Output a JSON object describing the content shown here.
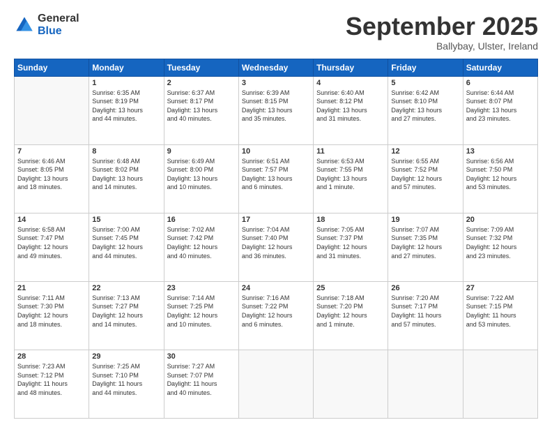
{
  "logo": {
    "general": "General",
    "blue": "Blue"
  },
  "header": {
    "title": "September 2025",
    "location": "Ballybay, Ulster, Ireland"
  },
  "days_of_week": [
    "Sunday",
    "Monday",
    "Tuesday",
    "Wednesday",
    "Thursday",
    "Friday",
    "Saturday"
  ],
  "weeks": [
    [
      {
        "day": "",
        "info": ""
      },
      {
        "day": "1",
        "info": "Sunrise: 6:35 AM\nSunset: 8:19 PM\nDaylight: 13 hours\nand 44 minutes."
      },
      {
        "day": "2",
        "info": "Sunrise: 6:37 AM\nSunset: 8:17 PM\nDaylight: 13 hours\nand 40 minutes."
      },
      {
        "day": "3",
        "info": "Sunrise: 6:39 AM\nSunset: 8:15 PM\nDaylight: 13 hours\nand 35 minutes."
      },
      {
        "day": "4",
        "info": "Sunrise: 6:40 AM\nSunset: 8:12 PM\nDaylight: 13 hours\nand 31 minutes."
      },
      {
        "day": "5",
        "info": "Sunrise: 6:42 AM\nSunset: 8:10 PM\nDaylight: 13 hours\nand 27 minutes."
      },
      {
        "day": "6",
        "info": "Sunrise: 6:44 AM\nSunset: 8:07 PM\nDaylight: 13 hours\nand 23 minutes."
      }
    ],
    [
      {
        "day": "7",
        "info": "Sunrise: 6:46 AM\nSunset: 8:05 PM\nDaylight: 13 hours\nand 18 minutes."
      },
      {
        "day": "8",
        "info": "Sunrise: 6:48 AM\nSunset: 8:02 PM\nDaylight: 13 hours\nand 14 minutes."
      },
      {
        "day": "9",
        "info": "Sunrise: 6:49 AM\nSunset: 8:00 PM\nDaylight: 13 hours\nand 10 minutes."
      },
      {
        "day": "10",
        "info": "Sunrise: 6:51 AM\nSunset: 7:57 PM\nDaylight: 13 hours\nand 6 minutes."
      },
      {
        "day": "11",
        "info": "Sunrise: 6:53 AM\nSunset: 7:55 PM\nDaylight: 13 hours\nand 1 minute."
      },
      {
        "day": "12",
        "info": "Sunrise: 6:55 AM\nSunset: 7:52 PM\nDaylight: 12 hours\nand 57 minutes."
      },
      {
        "day": "13",
        "info": "Sunrise: 6:56 AM\nSunset: 7:50 PM\nDaylight: 12 hours\nand 53 minutes."
      }
    ],
    [
      {
        "day": "14",
        "info": "Sunrise: 6:58 AM\nSunset: 7:47 PM\nDaylight: 12 hours\nand 49 minutes."
      },
      {
        "day": "15",
        "info": "Sunrise: 7:00 AM\nSunset: 7:45 PM\nDaylight: 12 hours\nand 44 minutes."
      },
      {
        "day": "16",
        "info": "Sunrise: 7:02 AM\nSunset: 7:42 PM\nDaylight: 12 hours\nand 40 minutes."
      },
      {
        "day": "17",
        "info": "Sunrise: 7:04 AM\nSunset: 7:40 PM\nDaylight: 12 hours\nand 36 minutes."
      },
      {
        "day": "18",
        "info": "Sunrise: 7:05 AM\nSunset: 7:37 PM\nDaylight: 12 hours\nand 31 minutes."
      },
      {
        "day": "19",
        "info": "Sunrise: 7:07 AM\nSunset: 7:35 PM\nDaylight: 12 hours\nand 27 minutes."
      },
      {
        "day": "20",
        "info": "Sunrise: 7:09 AM\nSunset: 7:32 PM\nDaylight: 12 hours\nand 23 minutes."
      }
    ],
    [
      {
        "day": "21",
        "info": "Sunrise: 7:11 AM\nSunset: 7:30 PM\nDaylight: 12 hours\nand 18 minutes."
      },
      {
        "day": "22",
        "info": "Sunrise: 7:13 AM\nSunset: 7:27 PM\nDaylight: 12 hours\nand 14 minutes."
      },
      {
        "day": "23",
        "info": "Sunrise: 7:14 AM\nSunset: 7:25 PM\nDaylight: 12 hours\nand 10 minutes."
      },
      {
        "day": "24",
        "info": "Sunrise: 7:16 AM\nSunset: 7:22 PM\nDaylight: 12 hours\nand 6 minutes."
      },
      {
        "day": "25",
        "info": "Sunrise: 7:18 AM\nSunset: 7:20 PM\nDaylight: 12 hours\nand 1 minute."
      },
      {
        "day": "26",
        "info": "Sunrise: 7:20 AM\nSunset: 7:17 PM\nDaylight: 11 hours\nand 57 minutes."
      },
      {
        "day": "27",
        "info": "Sunrise: 7:22 AM\nSunset: 7:15 PM\nDaylight: 11 hours\nand 53 minutes."
      }
    ],
    [
      {
        "day": "28",
        "info": "Sunrise: 7:23 AM\nSunset: 7:12 PM\nDaylight: 11 hours\nand 48 minutes."
      },
      {
        "day": "29",
        "info": "Sunrise: 7:25 AM\nSunset: 7:10 PM\nDaylight: 11 hours\nand 44 minutes."
      },
      {
        "day": "30",
        "info": "Sunrise: 7:27 AM\nSunset: 7:07 PM\nDaylight: 11 hours\nand 40 minutes."
      },
      {
        "day": "",
        "info": ""
      },
      {
        "day": "",
        "info": ""
      },
      {
        "day": "",
        "info": ""
      },
      {
        "day": "",
        "info": ""
      }
    ]
  ]
}
